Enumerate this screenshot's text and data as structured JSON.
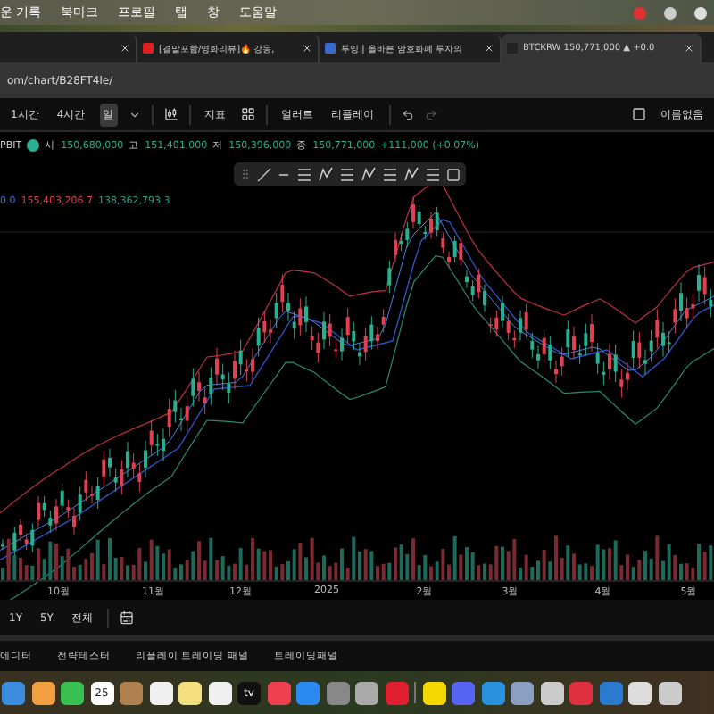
{
  "menu_bar": {
    "items": [
      "운 기록",
      "북마크",
      "프로필",
      "탭",
      "창",
      "도움말"
    ]
  },
  "tabs": [
    {
      "selected": false
    },
    {
      "title": "[결말포함/영화리뷰]🔥 강동,",
      "selected": false
    },
    {
      "title": "투잉 | 올바른 암호화폐 투자의",
      "selected": false
    },
    {
      "title": "BTCKRW 150,771,000 ▲ +0.0",
      "selected": true
    }
  ],
  "address_bar": {
    "url": "om/chart/B28FT4le/"
  },
  "toolbar": {
    "intervals": [
      {
        "label": "1시간",
        "selected": false
      },
      {
        "label": "4시간",
        "selected": false
      },
      {
        "label": "일",
        "selected": true
      }
    ],
    "indicators": "지표",
    "alert": "얼러트",
    "replay": "리플레이",
    "layout_name": "이름없음"
  },
  "legend": {
    "exchange": "PBIT",
    "ohlc": [
      {
        "label": "시",
        "value": "150,680,000"
      },
      {
        "label": "고",
        "value": "151,401,000"
      },
      {
        "label": "저",
        "value": "150,396,000"
      },
      {
        "label": "종",
        "value": "150,771,000"
      }
    ],
    "change": "+111,000 (+0.07%)"
  },
  "indicator_values": [
    {
      "text": "0.0",
      "color": "#3f6fd8"
    },
    {
      "text": "155,403,206.7",
      "color": "#e0404f"
    },
    {
      "text": "138,362,793.3",
      "color": "#2aa189"
    }
  ],
  "x_axis": [
    "10월",
    "11월",
    "12월",
    "2025",
    "2월",
    "3월",
    "4월",
    "5월"
  ],
  "range_buttons": [
    "1Y",
    "5Y",
    "전체"
  ],
  "bottom_tabs": [
    "에디터",
    "전략테스터",
    "리플레이 트레이딩 패널",
    "트레이딩패널"
  ],
  "dock": {
    "calendar_date": "25",
    "tv_label": "tv"
  }
}
